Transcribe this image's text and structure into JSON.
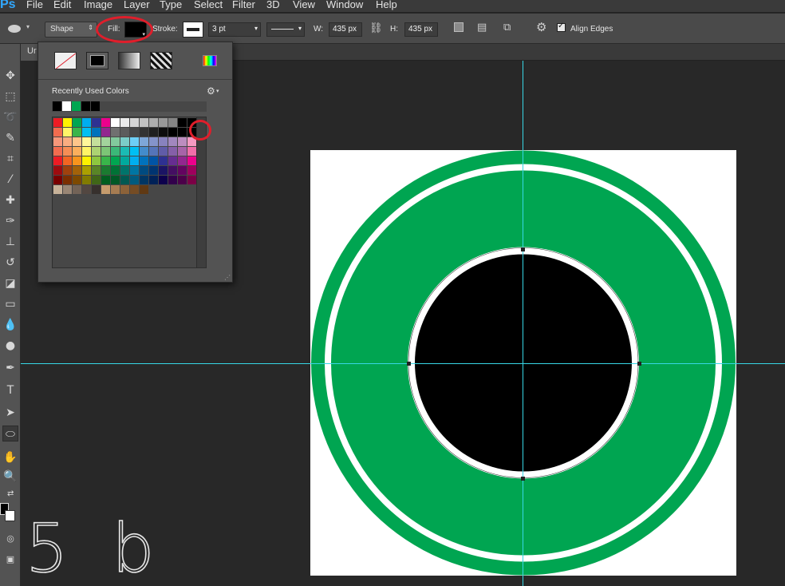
{
  "app": {
    "logo": "Ps"
  },
  "menu": [
    "File",
    "Edit",
    "Image",
    "Layer",
    "Type",
    "Select",
    "Filter",
    "3D",
    "View",
    "Window",
    "Help"
  ],
  "options": {
    "mode": "Shape",
    "fill_label": "Fill:",
    "fill_color": "#000000",
    "stroke_label": "Stroke:",
    "stroke_color": "#ffffff",
    "stroke_width": "3 pt",
    "w_label": "W:",
    "w_value": "435 px",
    "h_label": "H:",
    "h_value": "435 px",
    "align_edges_label": "Align Edges",
    "align_edges_checked": true
  },
  "document": {
    "tab_title": "Ur"
  },
  "swatch_panel": {
    "recent_label": "Recently Used Colors",
    "recent_colors": [
      "#000000",
      "#ffffff",
      "#00a651",
      "#000000",
      "#000000"
    ],
    "fill_types": [
      "no-color",
      "solid-color",
      "gradient",
      "pattern"
    ],
    "highlighted_swatch": "#000000"
  },
  "watermark_text": "5 b",
  "colors": {
    "ring_green": "#00a551",
    "ring_white": "#ffffff",
    "center_black": "#000000",
    "guide": "#37d7e6",
    "annotation_red": "#e01e2b"
  },
  "icons": {
    "tools": [
      "move-tool-icon",
      "marquee-tool-icon",
      "lasso-tool-icon",
      "quick-select-tool-icon",
      "crop-tool-icon",
      "eyedropper-tool-icon",
      "healing-brush-icon",
      "brush-tool-icon",
      "clone-stamp-icon",
      "history-brush-icon",
      "eraser-tool-icon",
      "gradient-tool-icon",
      "blur-tool-icon",
      "dodge-tool-icon",
      "pen-tool-icon",
      "type-tool-icon",
      "path-select-icon",
      "ellipse-tool-icon",
      "hand-tool-icon",
      "zoom-tool-icon"
    ]
  }
}
